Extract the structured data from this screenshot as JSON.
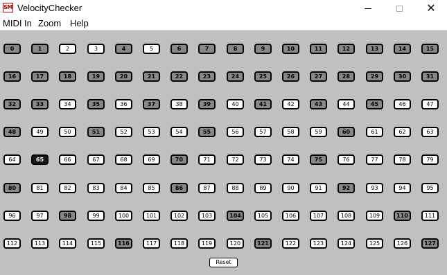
{
  "window": {
    "title": "VelocityChecker",
    "icon_label": "SM",
    "icon": "app-icon",
    "controls": [
      "minimize-icon",
      "maximize-icon",
      "close-icon"
    ]
  },
  "menu": {
    "items": [
      "MIDI In",
      "Zoom",
      "Help"
    ]
  },
  "grid": {
    "rows": 8,
    "columns": 16,
    "levels": [
      1,
      1,
      0,
      0,
      1,
      0,
      1,
      1,
      1,
      1,
      1,
      1,
      1,
      1,
      1,
      1,
      1,
      1,
      1,
      1,
      1,
      1,
      1,
      1,
      1,
      1,
      1,
      1,
      1,
      1,
      1,
      1,
      1,
      1,
      0,
      1,
      0,
      1,
      0,
      1,
      0,
      1,
      0,
      1,
      0,
      1,
      0,
      0,
      1,
      0,
      0,
      1,
      0,
      0,
      0,
      1,
      0,
      0,
      0,
      0,
      1,
      0,
      0,
      0,
      0,
      2,
      0,
      0,
      0,
      0,
      1,
      0,
      0,
      0,
      0,
      1,
      0,
      0,
      0,
      0,
      1,
      0,
      0,
      0,
      0,
      0,
      1,
      0,
      0,
      0,
      0,
      0,
      1,
      0,
      0,
      0,
      0,
      0,
      1,
      0,
      0,
      0,
      0,
      0,
      1,
      0,
      0,
      0,
      0,
      0,
      1,
      0,
      0,
      0,
      0,
      0,
      1,
      0,
      0,
      0,
      0,
      1,
      0,
      0,
      0,
      0,
      0,
      1
    ],
    "level_colors": [
      "#ffffff",
      "#888888",
      "#1a1a1a"
    ]
  },
  "reset_label": "Reset"
}
